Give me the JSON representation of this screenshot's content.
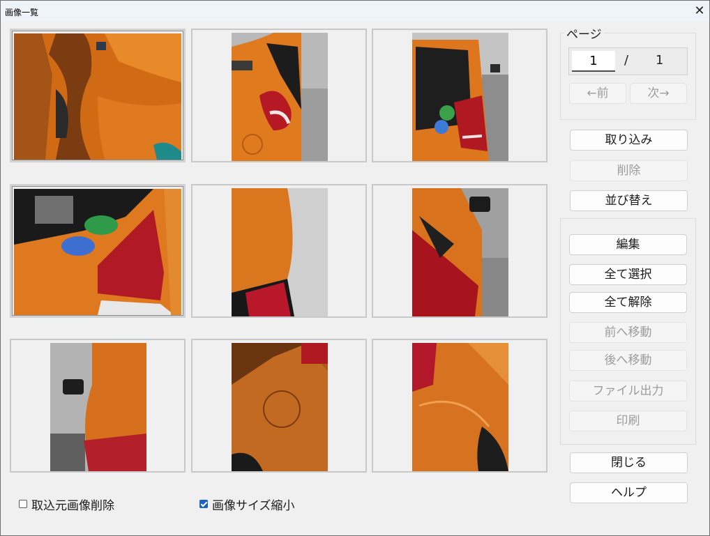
{
  "window": {
    "title": "画像一覧",
    "close_glyph": "✕"
  },
  "page_group": {
    "label": "ページ",
    "current_page": "1",
    "separator": "/",
    "total_pages": "1",
    "prev_label": "←前",
    "next_label": "次→"
  },
  "buttons": {
    "import": "取り込み",
    "delete": "削除",
    "sort": "並び替え",
    "edit": "編集",
    "select_all": "全て選択",
    "deselect_all": "全て解除",
    "move_prev": "前へ移動",
    "move_next": "後へ移動",
    "file_output": "ファイル出力",
    "print": "印刷",
    "close": "閉じる",
    "help": "ヘルプ"
  },
  "options": {
    "delete_source_label": "取込元画像削除",
    "delete_source_checked": false,
    "shrink_label": "画像サイズ縮小",
    "shrink_checked": true
  },
  "thumbnails": [
    {
      "subject": "dented orange door panel close-up",
      "selected": true
    },
    {
      "subject": "orange car rear with red tail lamp",
      "selected": false
    },
    {
      "subject": "damaged rear hatch with stickers",
      "selected": false
    },
    {
      "subject": "damaged tail lamp with stickers",
      "selected": true
    },
    {
      "subject": "rear quarter panel top view",
      "selected": false
    },
    {
      "subject": "tail lamp and side mirror",
      "selected": false
    },
    {
      "subject": "side mirror and rear light",
      "selected": false
    },
    {
      "subject": "rear fender with fuel lid",
      "selected": false
    },
    {
      "subject": "rear fender reflection",
      "selected": false
    }
  ],
  "colors": {
    "car_orange": "#d9741c",
    "lamp_red": "#b01822",
    "accent_blue": "#1863c4",
    "disabled_text": "#9c9c9c"
  }
}
